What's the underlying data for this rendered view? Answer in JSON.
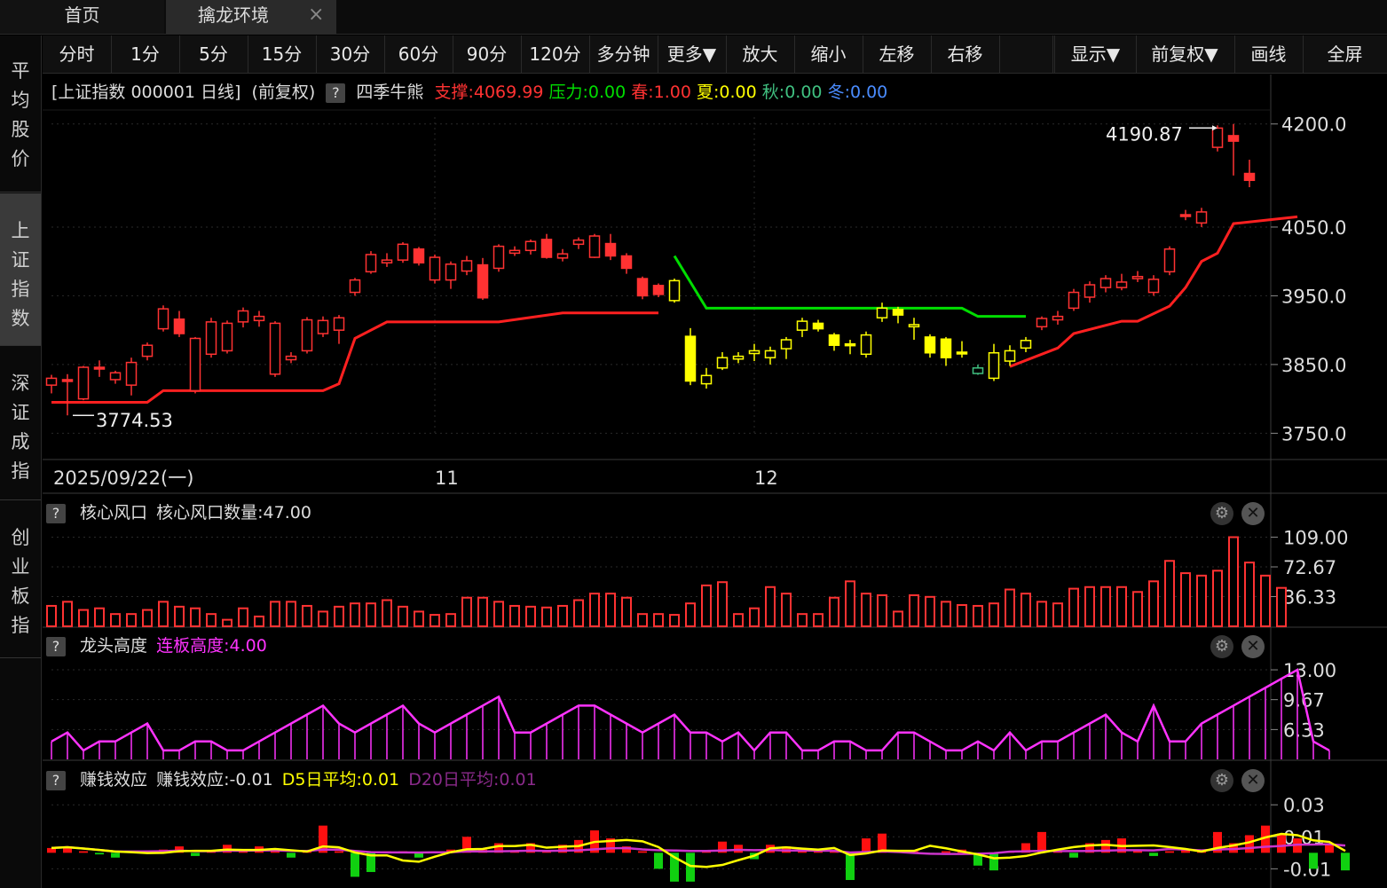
{
  "tabs": [
    {
      "label": "首页"
    },
    {
      "label": "擒龙环境",
      "close": "×"
    }
  ],
  "left_sidebar": [
    {
      "label": "平均股价",
      "active": false
    },
    {
      "label": "上证指数",
      "active": true
    },
    {
      "label": "深证成指",
      "active": false
    },
    {
      "label": "创业板指",
      "active": false
    }
  ],
  "toolbar": [
    "分时",
    "1分",
    "5分",
    "15分",
    "30分",
    "60分",
    "90分",
    "120分",
    "多分钟",
    "更多▼",
    "放大",
    "缩小",
    "左移",
    "右移",
    "",
    "显示▼",
    "前复权▼",
    "画线",
    "全屏"
  ],
  "kline_info": {
    "title": "[上证指数 000001 日线]",
    "adjust": "(前复权)",
    "help": "?",
    "indicator": "四季牛熊",
    "support": "支撑:4069.99",
    "pressure": "压力:0.00",
    "spring": "春:1.00",
    "summer": "夏:0.00",
    "autumn": "秋:0.00",
    "winter": "冬:0.00"
  },
  "colors": {
    "up": "#ff3232",
    "down_yellow": "#ffff00",
    "down_green": "#40c080",
    "pressure": "#00dd00",
    "support": "#ff2020",
    "ma5": "#ffff00",
    "ma20": "#cc33cc",
    "magenta": "#ff33ff",
    "grid": "#2a2a2a"
  },
  "chart_data": [
    {
      "type": "candlestick",
      "name": "上证指数 日线",
      "y_ticks": [
        "4200.0",
        "4050.0",
        "3950.0",
        "3850.0",
        "3750.0"
      ],
      "ylim": [
        3735,
        4210
      ],
      "x_labels": [
        {
          "index": 0,
          "label": "2025/09/22(一)"
        },
        {
          "index": 24,
          "label": "11"
        },
        {
          "index": 44,
          "label": "12"
        }
      ],
      "annotations": {
        "high": {
          "index": 73,
          "label": "4190.87"
        },
        "low": {
          "index": 1,
          "label": "3774.53"
        }
      },
      "candles": [
        [
          3820,
          3830,
          3835,
          3808,
          "r"
        ],
        [
          3828,
          3826,
          3836,
          3776,
          "r"
        ],
        [
          3800,
          3846,
          3848,
          3798,
          "r"
        ],
        [
          3846,
          3845,
          3856,
          3832,
          "r"
        ],
        [
          3828,
          3838,
          3841,
          3822,
          "r"
        ],
        [
          3820,
          3853,
          3860,
          3805,
          "r"
        ],
        [
          3862,
          3878,
          3882,
          3856,
          "r"
        ],
        [
          3902,
          3931,
          3936,
          3898,
          "r"
        ],
        [
          3916,
          3895,
          3928,
          3890,
          "r"
        ],
        [
          3812,
          3888,
          3890,
          3808,
          "r"
        ],
        [
          3865,
          3912,
          3918,
          3860,
          "r"
        ],
        [
          3870,
          3910,
          3914,
          3866,
          "r"
        ],
        [
          3912,
          3928,
          3933,
          3904,
          "r"
        ],
        [
          3914,
          3920,
          3928,
          3905,
          "r"
        ],
        [
          3836,
          3910,
          3913,
          3832,
          "r"
        ],
        [
          3857,
          3862,
          3868,
          3852,
          "r"
        ],
        [
          3870,
          3915,
          3919,
          3866,
          "r"
        ],
        [
          3895,
          3914,
          3920,
          3890,
          "r"
        ],
        [
          3900,
          3918,
          3922,
          3880,
          "r"
        ],
        [
          3955,
          3973,
          3976,
          3950,
          "r"
        ],
        [
          3985,
          4010,
          4015,
          3982,
          "r"
        ],
        [
          3998,
          4002,
          4012,
          3992,
          "r"
        ],
        [
          4002,
          4025,
          4028,
          3998,
          "r"
        ],
        [
          4018,
          3998,
          4021,
          3994,
          "r"
        ],
        [
          3973,
          4006,
          4010,
          3968,
          "r"
        ],
        [
          3973,
          3996,
          4000,
          3960,
          "r"
        ],
        [
          3986,
          4001,
          4008,
          3980,
          "r"
        ],
        [
          3995,
          3947,
          4005,
          3944,
          "r"
        ],
        [
          3990,
          4022,
          4025,
          3985,
          "r"
        ],
        [
          4012,
          4016,
          4022,
          4008,
          "r"
        ],
        [
          4016,
          4029,
          4032,
          4010,
          "r"
        ],
        [
          4032,
          4006,
          4040,
          4004,
          "r"
        ],
        [
          4005,
          4011,
          4018,
          4000,
          "r"
        ],
        [
          4025,
          4031,
          4035,
          4018,
          "r"
        ],
        [
          4006,
          4037,
          4040,
          4005,
          "r"
        ],
        [
          4026,
          4008,
          4040,
          4002,
          "r"
        ],
        [
          4008,
          3990,
          4012,
          3982,
          "r"
        ],
        [
          3975,
          3950,
          3978,
          3945,
          "r"
        ],
        [
          3965,
          3952,
          3968,
          3948,
          "r"
        ],
        [
          3943,
          3972,
          3975,
          3940,
          "y"
        ],
        [
          3891,
          3826,
          3903,
          3820,
          "y"
        ],
        [
          3822,
          3834,
          3845,
          3815,
          "y"
        ],
        [
          3845,
          3860,
          3868,
          3842,
          "y"
        ],
        [
          3858,
          3862,
          3868,
          3852,
          "y"
        ],
        [
          3866,
          3870,
          3880,
          3855,
          "y"
        ],
        [
          3860,
          3870,
          3876,
          3850,
          "y"
        ],
        [
          3873,
          3886,
          3890,
          3858,
          "y"
        ],
        [
          3900,
          3913,
          3918,
          3890,
          "y"
        ],
        [
          3910,
          3902,
          3915,
          3898,
          "y"
        ],
        [
          3893,
          3878,
          3896,
          3870,
          "y"
        ],
        [
          3880,
          3878,
          3886,
          3865,
          "y"
        ],
        [
          3865,
          3893,
          3898,
          3860,
          "y"
        ],
        [
          3918,
          3932,
          3940,
          3912,
          "y"
        ],
        [
          3930,
          3922,
          3934,
          3910,
          "y"
        ],
        [
          3905,
          3908,
          3918,
          3886,
          "y"
        ],
        [
          3890,
          3867,
          3894,
          3860,
          "y"
        ],
        [
          3887,
          3860,
          3890,
          3848,
          "y"
        ],
        [
          3868,
          3867,
          3884,
          3860,
          "y"
        ],
        [
          3837,
          3845,
          3850,
          3835,
          "g"
        ],
        [
          3830,
          3867,
          3880,
          3826,
          "y"
        ],
        [
          3855,
          3870,
          3878,
          3848,
          "y"
        ],
        [
          3874,
          3885,
          3890,
          3868,
          "y"
        ],
        [
          3905,
          3917,
          3920,
          3900,
          "r"
        ],
        [
          3915,
          3920,
          3928,
          3908,
          "r"
        ],
        [
          3932,
          3955,
          3960,
          3928,
          "r"
        ],
        [
          3948,
          3966,
          3971,
          3940,
          "r"
        ],
        [
          3962,
          3975,
          3980,
          3955,
          "r"
        ],
        [
          3962,
          3970,
          3982,
          3958,
          "r"
        ],
        [
          3975,
          3978,
          3986,
          3970,
          "r"
        ],
        [
          3955,
          3974,
          3980,
          3950,
          "r"
        ],
        [
          3985,
          4018,
          4022,
          3980,
          "r"
        ],
        [
          4068,
          4066,
          4075,
          4060,
          "r"
        ],
        [
          4056,
          4072,
          4078,
          4050,
          "r"
        ],
        [
          4166,
          4194,
          4198,
          4160,
          "r"
        ],
        [
          4183,
          4175,
          4200,
          4125,
          "r"
        ],
        [
          4128,
          4118,
          4148,
          4108,
          "r"
        ]
      ],
      "support_line": [
        [
          0,
          3795
        ],
        [
          6,
          3795
        ],
        [
          7,
          3812
        ],
        [
          17,
          3812
        ],
        [
          18,
          3822
        ],
        [
          19,
          3888
        ],
        [
          21,
          3912
        ],
        [
          28,
          3912
        ],
        [
          32,
          3925
        ],
        [
          38,
          3925
        ],
        [
          60,
          3847
        ],
        [
          63,
          3874
        ],
        [
          64,
          3895
        ],
        [
          67,
          3913
        ],
        [
          68,
          3913
        ],
        [
          70,
          3935
        ],
        [
          71,
          3962
        ],
        [
          72,
          4000
        ],
        [
          73,
          4012
        ],
        [
          74,
          4055
        ],
        [
          78,
          4065
        ]
      ],
      "pressure_line": [
        [
          39,
          4008
        ],
        [
          41,
          3932
        ],
        [
          57,
          3932
        ],
        [
          58,
          3920
        ],
        [
          61,
          3920
        ]
      ]
    },
    {
      "type": "bar",
      "name": "核心风口",
      "title_label": "核心风口",
      "value_label": "核心风口数量:47.00",
      "y_ticks": [
        "109.00",
        "72.67",
        "36.33"
      ],
      "ylim": [
        0,
        115
      ],
      "values": [
        25,
        30,
        20,
        22,
        15,
        15,
        20,
        30,
        24,
        22,
        15,
        8,
        22,
        12,
        30,
        30,
        25,
        18,
        24,
        28,
        28,
        32,
        24,
        18,
        14,
        15,
        35,
        35,
        30,
        25,
        24,
        23,
        25,
        32,
        40,
        40,
        35,
        15,
        15,
        14,
        28,
        50,
        54,
        15,
        22,
        48,
        40,
        15,
        15,
        35,
        55,
        40,
        38,
        18,
        38,
        36,
        30,
        26,
        25,
        28,
        45,
        40,
        30,
        28,
        46,
        48,
        48,
        48,
        42,
        55,
        80,
        65,
        62,
        68,
        109,
        78,
        62,
        47
      ]
    },
    {
      "type": "line",
      "name": "龙头高度",
      "title_label": "龙头高度",
      "value_label": "连板高度:4.00",
      "y_ticks": [
        "13.00",
        "9.67",
        "6.33"
      ],
      "ylim": [
        3,
        13.5
      ],
      "values": [
        5,
        6,
        4,
        5,
        5,
        6,
        7,
        4,
        4,
        5,
        5,
        4,
        4,
        5,
        6,
        7,
        8,
        9,
        7,
        6,
        7,
        8,
        9,
        7,
        6,
        7,
        8,
        9,
        10,
        6,
        6,
        7,
        8,
        9,
        9,
        8,
        7,
        6,
        7,
        8,
        6,
        6,
        5,
        6,
        4,
        6,
        6,
        4,
        4,
        5,
        5,
        4,
        4,
        6,
        6,
        5,
        4,
        4,
        5,
        4,
        6,
        4,
        5,
        5,
        6,
        7,
        8,
        6,
        5,
        9,
        5,
        5,
        7,
        8,
        9,
        10,
        11,
        12,
        13,
        5,
        4
      ]
    },
    {
      "type": "bar",
      "name": "赚钱效应",
      "title_label": "赚钱效应",
      "value_label": "赚钱效应:-0.01",
      "ma5_label": "D5日平均:0.01",
      "ma20_label": "D20日平均:0.01",
      "y_ticks": [
        "0.03",
        "0.01",
        "-0.01"
      ],
      "ylim": [
        -0.022,
        0.034
      ],
      "values": [
        0.003,
        0.004,
        0.001,
        -0.001,
        -0.003,
        0.001,
        0.001,
        0.002,
        0.004,
        -0.002,
        0.001,
        0.005,
        0.001,
        0.004,
        0.001,
        -0.003,
        0.001,
        0.017,
        0.001,
        -0.015,
        -0.012,
        0.001,
        0.001,
        -0.003,
        0.001,
        0.002,
        0.01,
        0.002,
        0.006,
        0.001,
        0.006,
        0.001,
        0.005,
        0.008,
        0.014,
        0.009,
        0.004,
        0.001,
        -0.01,
        -0.018,
        -0.018,
        0.001,
        0.007,
        0.005,
        -0.004,
        0.005,
        0.004,
        0.003,
        0.002,
        0.001,
        -0.017,
        0.009,
        0.012,
        0.001,
        0.001,
        -0.001,
        0.001,
        0.002,
        -0.008,
        -0.011,
        0.001,
        0.006,
        0.013,
        0.001,
        -0.003,
        0.006,
        0.008,
        0.009,
        0.002,
        -0.002,
        0.001,
        0.002,
        0.001,
        0.013,
        0.006,
        0.011,
        0.017,
        0.012,
        0.009,
        -0.01,
        0.006,
        -0.011
      ]
    }
  ]
}
